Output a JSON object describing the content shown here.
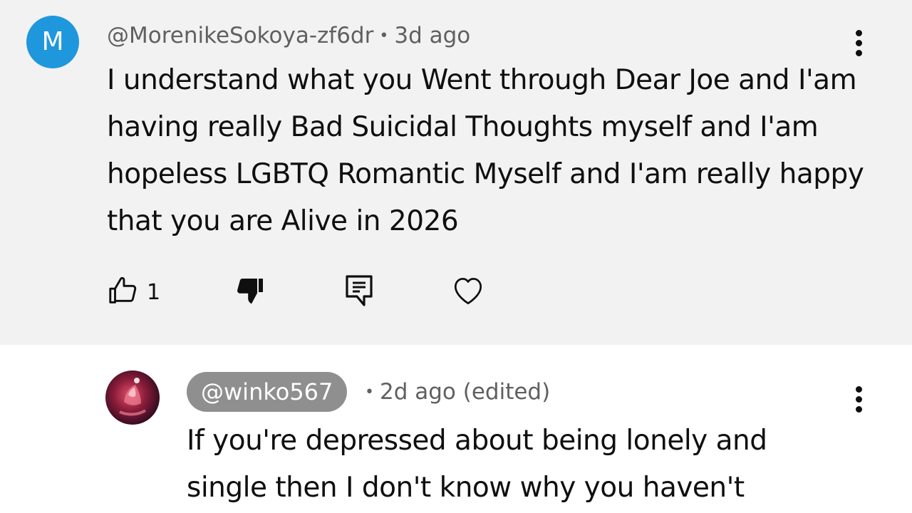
{
  "comments": [
    {
      "avatar_letter": "M",
      "avatar_color": "#1f97dc",
      "author": "@MorenikeSokoya-zf6dr",
      "separator": "•",
      "time": "3d ago",
      "text": "I understand what you Went through Dear Joe and I'am having really Bad Suicidal Thoughts myself and I'am hopeless LGBTQ Romantic Myself and I'am really happy that you are Alive in 2026",
      "like_count": "1",
      "icons": [
        "thumbs-up-icon",
        "thumbs-down-icon",
        "reply-icon",
        "heart-icon",
        "more-vert-icon"
      ]
    },
    {
      "author": "@winko567",
      "separator": "•",
      "time": "2d ago (edited)",
      "text": "If you're depressed about being lonely and single then I don't know why you haven't",
      "icons": [
        "more-vert-icon"
      ]
    }
  ],
  "colors": {
    "highlight_background": "#f2f2f2",
    "author_chip": "#8f8f8f",
    "meta_text": "#606060"
  }
}
